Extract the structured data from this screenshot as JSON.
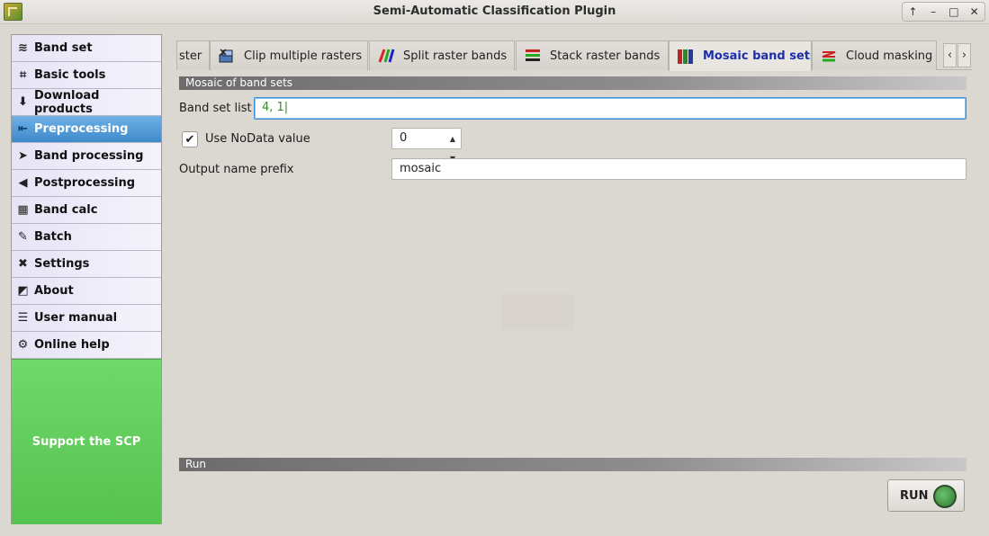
{
  "window": {
    "title": "Semi-Automatic Classification Plugin",
    "controls": [
      "↑",
      "–",
      "□",
      "✕"
    ]
  },
  "sidebar": {
    "items": [
      {
        "label": "Band set",
        "icon": "band-set-icon",
        "glyph": "≋"
      },
      {
        "label": "Basic tools",
        "icon": "basic-tools-icon",
        "glyph": "⌗"
      },
      {
        "label": "Download products",
        "icon": "download-icon",
        "glyph": "⬇"
      },
      {
        "label": "Preprocessing",
        "icon": "preprocessing-icon",
        "glyph": "⇤"
      },
      {
        "label": "Band processing",
        "icon": "band-processing-icon",
        "glyph": "➤"
      },
      {
        "label": "Postprocessing",
        "icon": "postprocessing-icon",
        "glyph": "◀"
      },
      {
        "label": "Band calc",
        "icon": "calculator-icon",
        "glyph": "▦"
      },
      {
        "label": "Batch",
        "icon": "batch-icon",
        "glyph": "✎"
      },
      {
        "label": "Settings",
        "icon": "settings-icon",
        "glyph": "✖"
      },
      {
        "label": "About",
        "icon": "about-icon",
        "glyph": "◩"
      },
      {
        "label": "User manual",
        "icon": "manual-icon",
        "glyph": "☰"
      },
      {
        "label": "Online help",
        "icon": "help-icon",
        "glyph": "⚙"
      }
    ],
    "active_index": 3,
    "support_label": "Support the SCP"
  },
  "tabs": [
    {
      "label": "ster"
    },
    {
      "label": "Clip multiple rasters"
    },
    {
      "label": "Split raster bands"
    },
    {
      "label": "Stack raster bands"
    },
    {
      "label": "Mosaic band sets",
      "active": true
    },
    {
      "label": "Cloud masking"
    }
  ],
  "tab_scroll": {
    "left": "‹",
    "right": "›"
  },
  "mosaic": {
    "section_title": "Mosaic of band sets",
    "band_set_list_label": "Band set list",
    "band_set_list_value": "4, 1|",
    "nodata_label": "Use NoData value",
    "nodata_checked": "✔",
    "nodata_value": "0",
    "output_prefix_label": "Output name prefix",
    "output_prefix_value": "mosaic"
  },
  "run": {
    "section_title": "Run",
    "button_label": "RUN"
  },
  "colors": {
    "active_tab_text": "#1b2fa8",
    "sidebar_active": "#3f8acb",
    "support_green": "#5fcf59"
  }
}
